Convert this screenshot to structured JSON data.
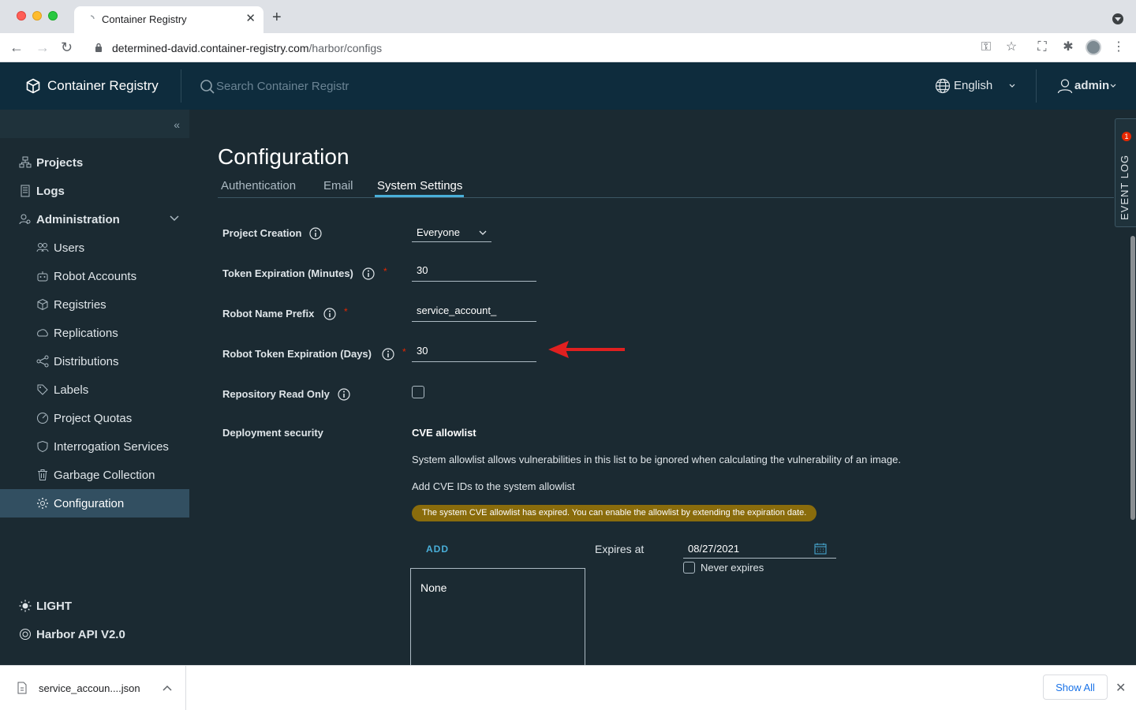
{
  "browser": {
    "tab_title": "Container Registry",
    "url_host": "determined-david.container-registry.com",
    "url_path": "/harbor/configs"
  },
  "header": {
    "brand": "Container Registry",
    "search_placeholder": "Search Container Registr",
    "language": "English",
    "user": "admin"
  },
  "sidebar": {
    "items": [
      {
        "label": "Projects",
        "icon": "projects-icon"
      },
      {
        "label": "Logs",
        "icon": "logs-icon"
      },
      {
        "label": "Administration",
        "icon": "administration-icon"
      },
      {
        "label": "Users",
        "icon": "users-icon"
      },
      {
        "label": "Robot Accounts",
        "icon": "robot-icon"
      },
      {
        "label": "Registries",
        "icon": "registries-icon"
      },
      {
        "label": "Replications",
        "icon": "replications-icon"
      },
      {
        "label": "Distributions",
        "icon": "distributions-icon"
      },
      {
        "label": "Labels",
        "icon": "labels-icon"
      },
      {
        "label": "Project Quotas",
        "icon": "quotas-icon"
      },
      {
        "label": "Interrogation Services",
        "icon": "shield-icon"
      },
      {
        "label": "Garbage Collection",
        "icon": "trash-icon"
      },
      {
        "label": "Configuration",
        "icon": "gear-icon"
      }
    ],
    "theme_toggle": "LIGHT",
    "api_link": "Harbor API V2.0"
  },
  "main": {
    "title": "Configuration",
    "tabs": [
      "Authentication",
      "Email",
      "System Settings"
    ],
    "active_tab": "System Settings",
    "form": {
      "project_creation_label": "Project Creation",
      "project_creation_value": "Everyone",
      "token_expiration_label": "Token Expiration (Minutes)",
      "token_expiration_value": "30",
      "robot_prefix_label": "Robot Name Prefix",
      "robot_prefix_value": "service_account_",
      "robot_token_label": "Robot Token Expiration (Days)",
      "robot_token_value": "30",
      "read_only_label": "Repository Read Only",
      "deployment_label": "Deployment security"
    },
    "cve": {
      "title": "CVE allowlist",
      "description": "System allowlist allows vulnerabilities in this list to be ignored when calculating the vulnerability of an image.",
      "add_text": "Add CVE IDs to the system allowlist",
      "warning": "The system CVE allowlist has expired. You can enable the allowlist by extending the expiration date.",
      "add_button": "ADD",
      "expires_label": "Expires at",
      "expires_value": "08/27/2021",
      "never_expires_label": "Never expires",
      "list_empty": "None"
    }
  },
  "event_log": {
    "label": "EVENT LOG",
    "count": "1"
  },
  "downloads": {
    "file_name": "service_accoun....json",
    "show_all": "Show All"
  },
  "colors": {
    "accent": "#49afd9",
    "header_bg": "#0e2c3d",
    "content_bg": "#1b2a32",
    "warning": "#8a6c0c",
    "required": "#e62700",
    "annotation_arrow": "#e02020"
  }
}
